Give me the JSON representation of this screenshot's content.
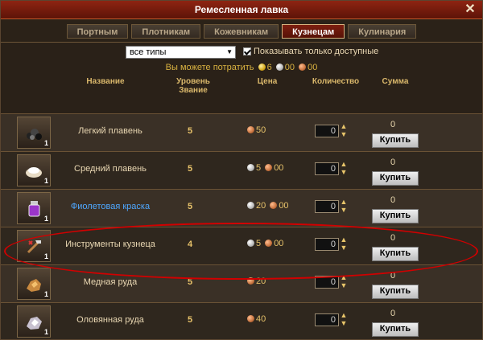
{
  "window": {
    "title": "Ремесленная лавка"
  },
  "tabs": [
    "Портным",
    "Плотникам",
    "Кожевникам",
    "Кузнецам",
    "Кулинария"
  ],
  "filter": {
    "type": "все типы",
    "only_available": "Показывать только доступные"
  },
  "spend": {
    "label": "Вы можете потратить",
    "gold": "6",
    "silver": "00",
    "copper": "00"
  },
  "headers": {
    "name": "Название",
    "level": "Уровень\nЗвание",
    "price": "Цена",
    "quantity": "Количество",
    "sum": "Сумма"
  },
  "items": [
    {
      "name": "Легкий плавень",
      "level": "5",
      "silver": "",
      "copper": "50",
      "qty": "0",
      "sum": "0",
      "buy": "Купить"
    },
    {
      "name": "Средний плавень",
      "level": "5",
      "silver": "5",
      "copper": "00",
      "qty": "0",
      "sum": "0",
      "buy": "Купить"
    },
    {
      "name": "Фиолетовая краска",
      "level": "5",
      "silver": "20",
      "copper": "00",
      "qty": "0",
      "sum": "0",
      "buy": "Купить"
    },
    {
      "name": "Инструменты кузнеца",
      "level": "4",
      "silver": "5",
      "copper": "00",
      "qty": "0",
      "sum": "0",
      "buy": "Купить"
    },
    {
      "name": "Медная руда",
      "level": "5",
      "silver": "",
      "copper": "20",
      "qty": "0",
      "sum": "0",
      "buy": "Купить"
    },
    {
      "name": "Оловянная руда",
      "level": "5",
      "silver": "",
      "copper": "40",
      "qty": "0",
      "sum": "0",
      "buy": "Купить"
    }
  ],
  "icon_qty": "1"
}
